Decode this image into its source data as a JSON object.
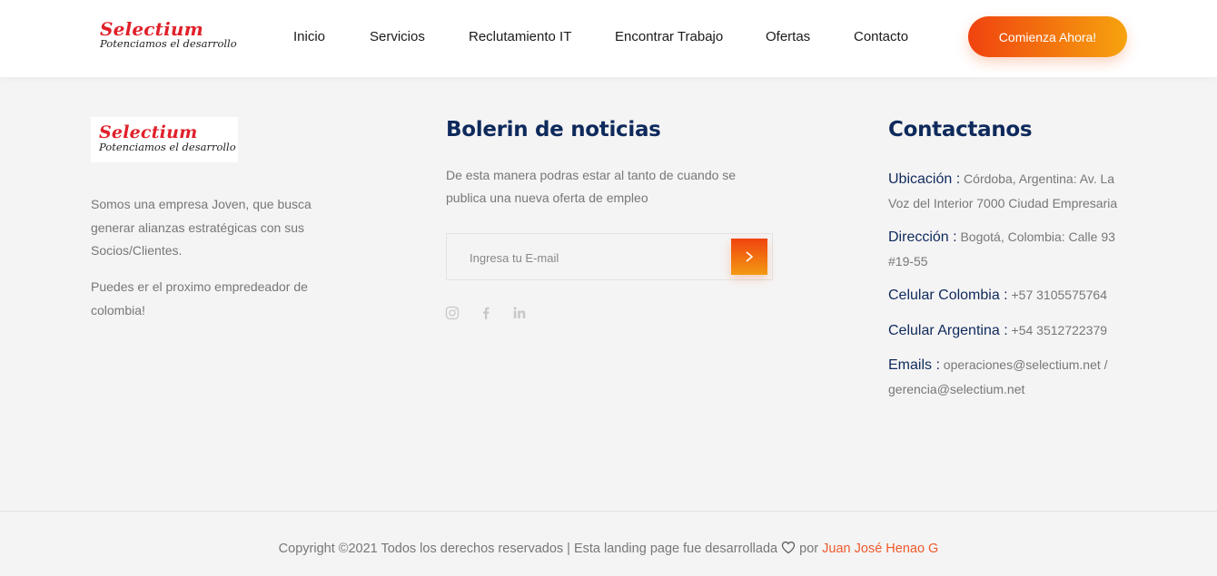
{
  "header": {
    "logo_title": "Selectium",
    "logo_subtitle": "Potenciamos el desarrollo",
    "nav": [
      "Inicio",
      "Servicios",
      "Reclutamiento IT",
      "Encontrar Trabajo",
      "Ofertas",
      "Contacto"
    ],
    "cta_label": "Comienza Ahora!"
  },
  "about": {
    "logo_title": "Selectium",
    "logo_subtitle": "Potenciamos el desarrollo",
    "paragraph1": "Somos una empresa Joven, que busca generar alianzas estratégicas con sus Socios/Clientes.",
    "paragraph2": "Puedes er el proximo empredeador de colombia!"
  },
  "newsletter": {
    "title": "Bolerin de noticias",
    "description": "De esta manera podras estar al tanto de cuando se publica una nueva oferta de empleo",
    "email_placeholder": "Ingresa tu E-mail",
    "social_icons": [
      "instagram-icon",
      "facebook-icon",
      "linkedin-icon"
    ]
  },
  "contact": {
    "title": "Contactanos",
    "items": [
      {
        "label": "Ubicación :",
        "value": "Córdoba, Argentina: Av. La Voz del Interior 7000 Ciudad Empresaria"
      },
      {
        "label": "Dirección :",
        "value": "Bogotá, Colombia: Calle 93 #19-55"
      },
      {
        "label": "Celular Colombia :",
        "value": "+57 3105575764"
      },
      {
        "label": "Celular Argentina :",
        "value": "+54 3512722379"
      },
      {
        "label": "Emails :",
        "value": "operaciones@selectium.net / gerencia@selectium.net"
      }
    ]
  },
  "footer": {
    "copyright_text": "Copyright ©2021 Todos los derechos reservados | Esta landing page fue desarrollada",
    "by_text": "por",
    "author": "Juan José Henao G"
  },
  "colors": {
    "brand_red": "#e0202a",
    "navy": "#0e2a5c",
    "accent_orange": "#f0430f",
    "accent_yellow": "#f6a30e",
    "author_link": "#ee5a2a"
  }
}
